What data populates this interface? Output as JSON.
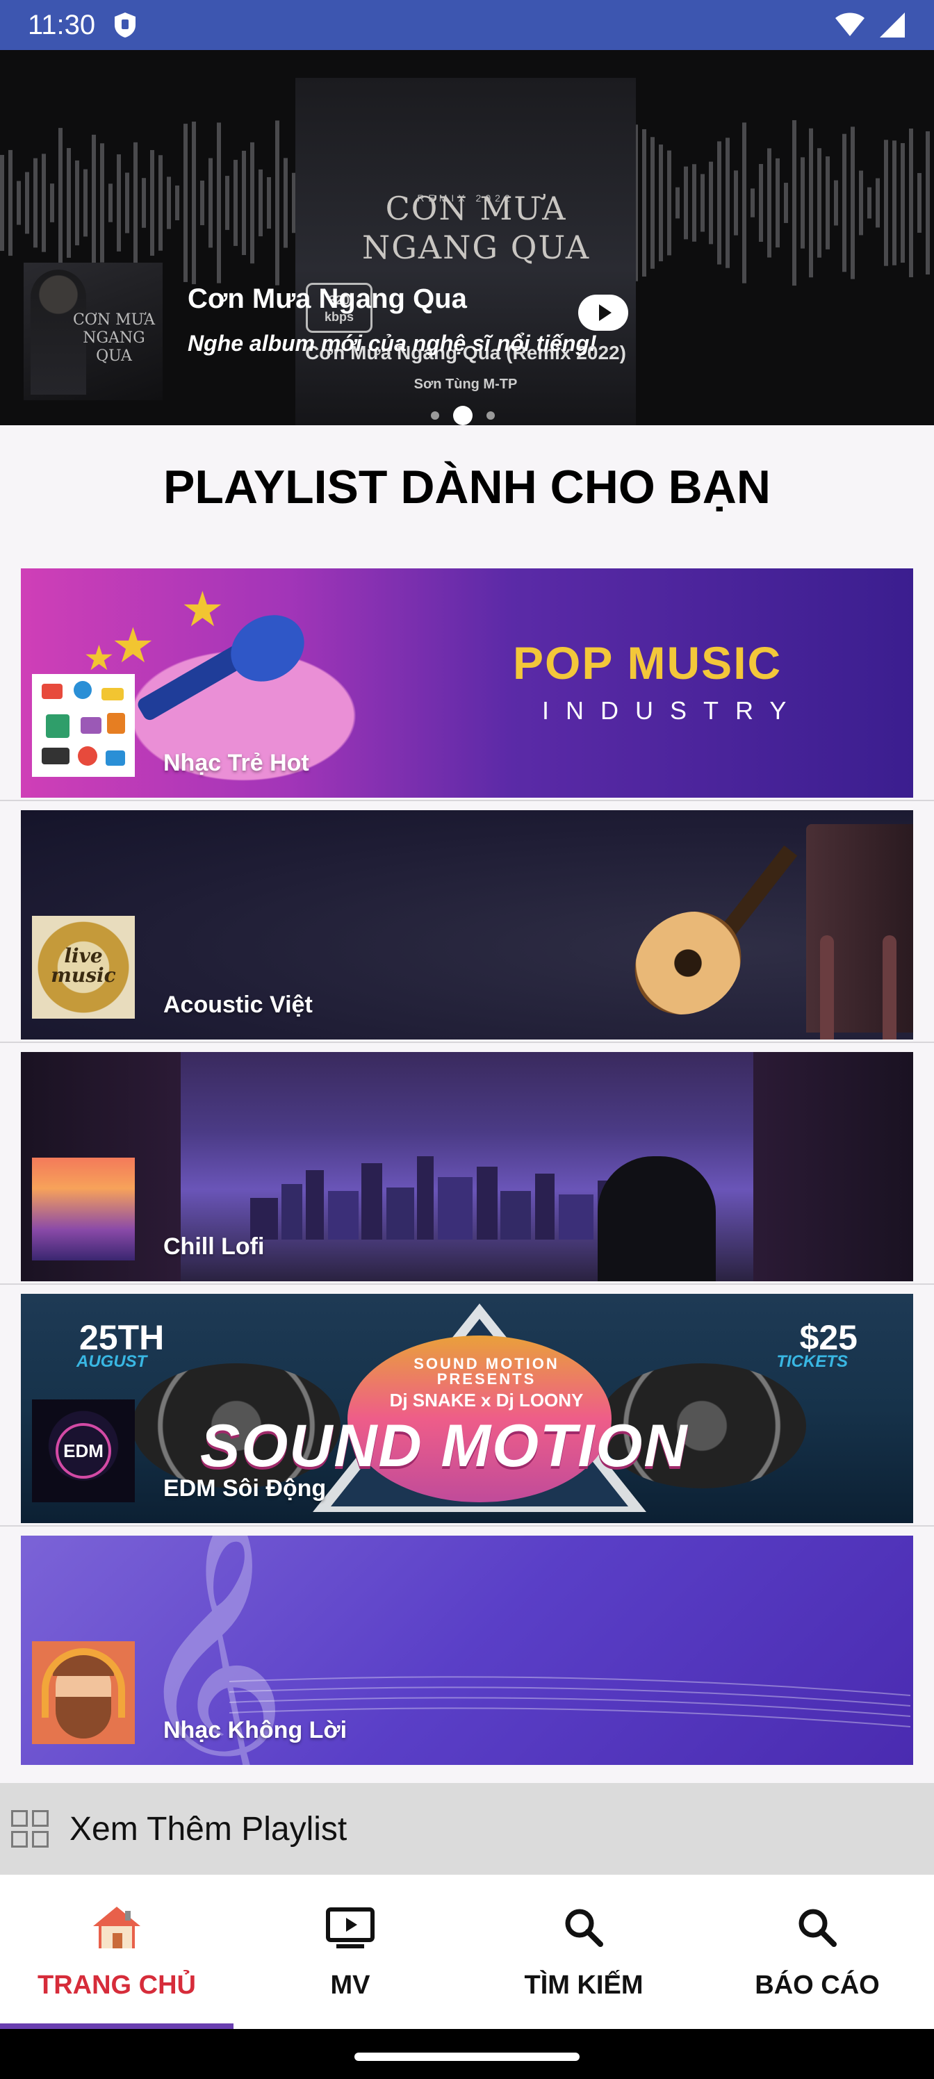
{
  "status_bar": {
    "time": "11:30",
    "icons": [
      "shield-icon",
      "wifi-icon",
      "signal-icon"
    ]
  },
  "banner": {
    "title": "Cơn Mưa Ngang Qua",
    "subtitle": "Nghe album mới của nghệ sĩ nổi tiếng!",
    "cover_text": {
      "remix_year": "REMIX 2022",
      "title_line1": "CƠN MƯA",
      "title_line2": "NGANG QUA",
      "bitrate_top": "320",
      "bitrate_unit": "kbps",
      "track_title": "Cơn Mưa Ngang Qua (Remix 2022)",
      "artist": "Sơn Tùng M-TP"
    },
    "pager": {
      "count": 3,
      "active_index": 1
    }
  },
  "section_title": "PLAYLIST DÀNH CHO BẠN",
  "playlists": [
    {
      "label": "Nhạc Trẻ Hot",
      "art_title": "POP MUSIC",
      "art_subtitle": "INDUSTRY"
    },
    {
      "label": "Acoustic Việt",
      "thumb_text": "live music"
    },
    {
      "label": "Chill Lofi"
    },
    {
      "label": "EDM Sôi Động",
      "thumb_text": "EDM",
      "poster": {
        "date_big": "25TH",
        "date_month": "AUGUST",
        "price": "$25",
        "price_label": "TICKETS",
        "presents": "SOUND MOTION PRESENTS",
        "djs": "Dj SNAKE x Dj LOONY",
        "headline": "SOUND MOTION"
      }
    },
    {
      "label": "Nhạc Không Lời"
    }
  ],
  "more_playlists": {
    "label": "Xem Thêm Playlist",
    "icon": "grid-icon"
  },
  "bottom_nav": [
    {
      "label": "TRANG CHỦ",
      "icon": "home-icon",
      "active": true
    },
    {
      "label": "MV",
      "icon": "tv-play-icon",
      "active": false
    },
    {
      "label": "TÌM KIẾM",
      "icon": "search-icon",
      "active": false
    },
    {
      "label": "BÁO CÁO",
      "icon": "search-icon",
      "active": false
    }
  ],
  "colors": {
    "status_bar": "#3d56b0",
    "active_nav_label": "#d62c3a",
    "active_nav_indicator": "#6a3fb0",
    "more_bar_bg": "#dbdbdb"
  }
}
